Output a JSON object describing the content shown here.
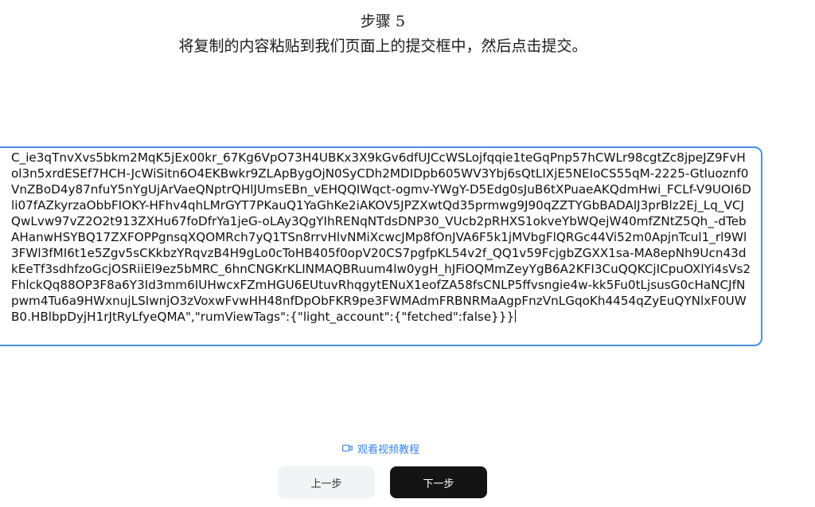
{
  "step": {
    "title": "步骤 5",
    "description": "将复制的内容粘贴到我们页面上的提交框中，然后点击提交。"
  },
  "paste_box": {
    "value": "C_ie3qTnvXvs5bkm2MqK5jEx00kr_67Kg6VpO73H4UBKx3X9kGv6dfUJCcWSLojfqqie1teGqPnp57hCWLr98cgtZc8jpeJZ9FvHol3n5xrdESEf7HCH-JcWiSitn6O4EKBwkr9ZLApBygOjN0SyCDh2MDIDpb605WV3Ybj6sQtLIXjE5NEIoCS55qM-2225-Gtluoznf0VnZBoD4y87nfuY5nYgUjArVaeQNptrQHlJUmsEBn_vEHQQIWqct-ogmv-YWgY-D5Edg0sJuB6tXPuaeAKQdmHwi_FCLf-V9UOI6Dli07fAZkyrzaObbFIOKY-HFhv4qhLMrGYT7PKauQ1YaGhKe2iAKOV5JPZXwtQd35prmwg9J90qZZTYGbBADAlJ3prBlz2Ej_Lq_VCJQwLvw97vZ2O2t913ZXHu67foDfrYa1jeG-oLAy3QgYIhRENqNTdsDNP30_VUcb2pRHXS1okveYbWQejW40mfZNtZ5Qh_-dTebAHanwHSYBQ17ZXFOPPgnsqXQOMRch7yQ1TSn8rrvHlvNMiXcwcJMp8fOnJVA6F5k1jMVbgFlQRGc44Vi52m0ApjnTcul1_rl9Wl3FWl3fMI6t1e5Zgv5sCKkbzYRqvzB4H9gLo0cToHB405f0opV20CS7pgfpKL54v2f_QQ1v59FcjgbZGXX1sa-MA8epNh9Ucn43dkEeTf3sdhfzoGcjOSRiiEl9ez5bMRC_6hnCNGKrKLINMAQBRuum4lw0ygH_hJFiOQMmZeyYgB6A2KFI3CuQQKCjICpuOXlYi4sVs2FhlckQq88OP3F8a6Y3Id3mm6IUHwcxFZmHGU6EUtuvRhqgytENuX1eofZA58fsCNLP5ffvsngie4w-kk5Fu0tLjsusG0cHaNCJfNpwm4Tu6a9HWxnujLSIwnjO3zVoxwFvwHH48nfDpObFKR9pe3FWMAdmFRBNRMaAgpFnzVnLGqoKh4454qZyEuQYNlxF0UWB0.HBlbpDyjH1rJtRyLfyeQMA\",\"rumViewTags\":{\"light_account\":{\"fetched\":false}}}"
  },
  "video_link": {
    "label": "观看视频教程",
    "icon": "video-camera-icon",
    "color": "#3b82f6"
  },
  "buttons": {
    "prev_label": "上一步",
    "next_label": "下一步"
  },
  "colors": {
    "input_border": "#4a90e2",
    "prev_bg": "#f2f3f5",
    "next_bg": "#141414"
  }
}
